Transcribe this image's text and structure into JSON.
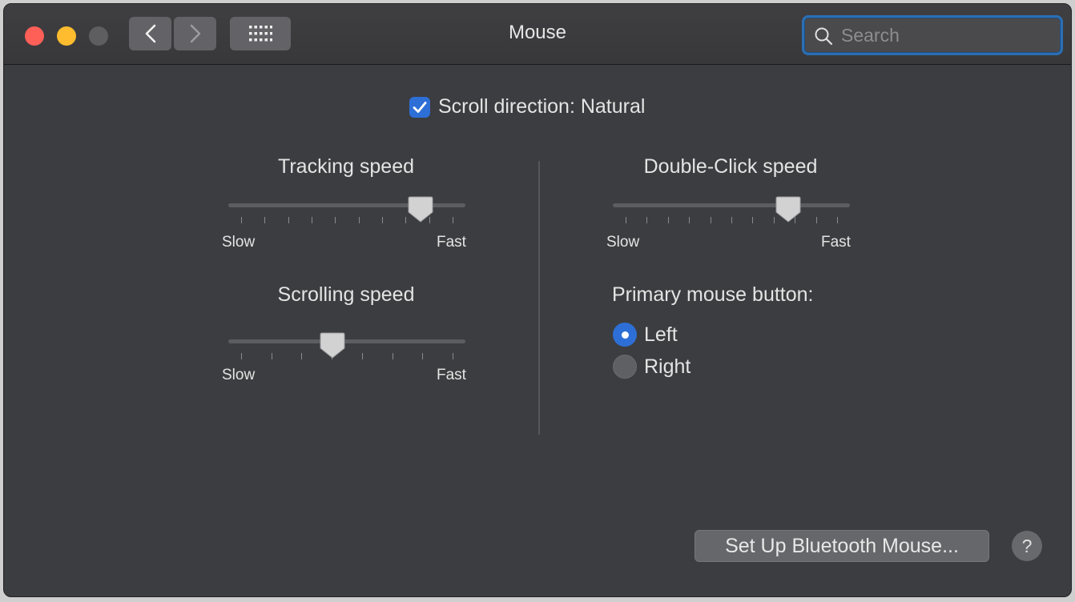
{
  "window": {
    "title": "Mouse"
  },
  "toolbar": {
    "back_icon": "chevron-left-icon",
    "forward_icon": "chevron-right-icon",
    "show_all_icon": "grid-icon"
  },
  "search": {
    "placeholder": "Search",
    "value": ""
  },
  "scroll_direction": {
    "label": "Scroll direction: Natural",
    "checked": true
  },
  "tracking_speed": {
    "title": "Tracking speed",
    "min_label": "Slow",
    "max_label": "Fast",
    "value": 0.85,
    "ticks": 10
  },
  "scrolling_speed": {
    "title": "Scrolling speed",
    "min_label": "Slow",
    "max_label": "Fast",
    "value": 0.43,
    "ticks": 8
  },
  "double_click_speed": {
    "title": "Double-Click speed",
    "min_label": "Slow",
    "max_label": "Fast",
    "value": 0.77,
    "ticks": 11
  },
  "primary_button": {
    "title": "Primary mouse button:",
    "options": [
      {
        "label": "Left",
        "selected": true
      },
      {
        "label": "Right",
        "selected": false
      }
    ]
  },
  "footer": {
    "bluetooth_button": "Set Up Bluetooth Mouse...",
    "help_button": "?"
  },
  "colors": {
    "accent": "#2d6fd6",
    "close": "#fe5f57",
    "minimize": "#febc2e",
    "window_bg": "#3c3d40"
  }
}
